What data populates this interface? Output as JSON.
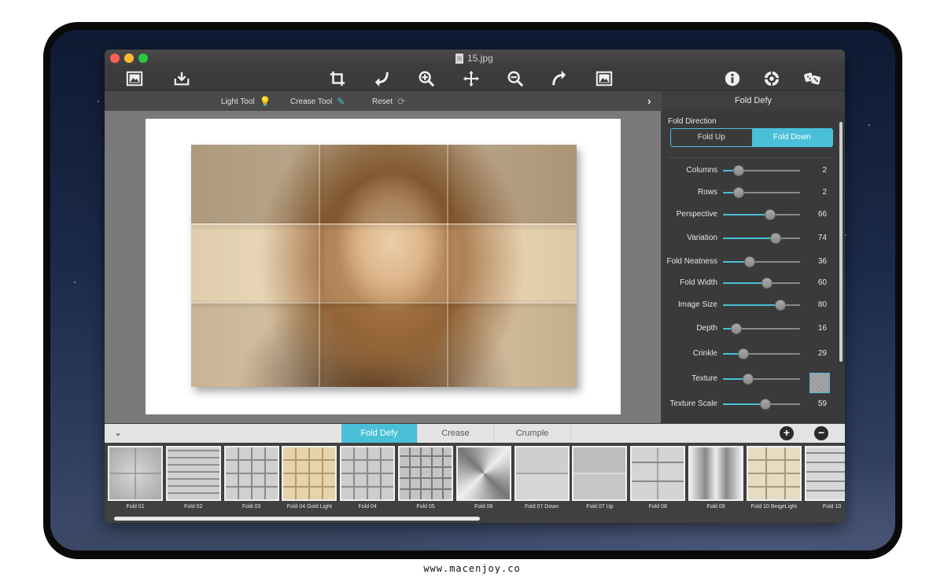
{
  "window": {
    "title": "15.jpg"
  },
  "toolbar": {
    "icons": [
      "image-icon",
      "import-icon",
      "crop-icon",
      "undo-icon",
      "zoom-in-icon",
      "move-icon",
      "zoom-out-icon",
      "redo-icon",
      "fit-image-icon",
      "info-icon",
      "settings-icon",
      "random-dice-icon"
    ]
  },
  "subbar": {
    "light_tool": "Light Tool",
    "crease_tool": "Crease Tool",
    "reset": "Reset"
  },
  "panel": {
    "title": "Fold Defy",
    "fold_direction_label": "Fold Direction",
    "fold_up": "Fold Up",
    "fold_down": "Fold Down",
    "fold_direction_selected": "Fold Down",
    "sliders": [
      {
        "label": "Columns",
        "value": "2",
        "fraction": 0.2
      },
      {
        "label": "Rows",
        "value": "2",
        "fraction": 0.2
      },
      {
        "label": "Perspective",
        "value": "66",
        "fraction": 0.61
      },
      {
        "label": "Variation",
        "value": "74",
        "fraction": 0.68
      },
      {
        "label": "Fold Neatness",
        "value": "36",
        "fraction": 0.35
      },
      {
        "label": "Fold Width",
        "value": "60",
        "fraction": 0.57
      },
      {
        "label": "Image Size",
        "value": "80",
        "fraction": 0.74
      },
      {
        "label": "Depth",
        "value": "16",
        "fraction": 0.17
      },
      {
        "label": "Crinkle",
        "value": "29",
        "fraction": 0.27
      },
      {
        "label": "Texture",
        "value": "",
        "fraction": 0.33
      },
      {
        "label": "Texture Scale",
        "value": "59",
        "fraction": 0.55
      }
    ]
  },
  "tabs": [
    {
      "label": "Fold Defy",
      "active": true
    },
    {
      "label": "Crease",
      "active": false
    },
    {
      "label": "Crumple",
      "active": false
    }
  ],
  "presets": [
    {
      "label": "Fold 01"
    },
    {
      "label": "Fold 02"
    },
    {
      "label": "Fold 03"
    },
    {
      "label": "Fold 04 Gold Light"
    },
    {
      "label": "Fold 04"
    },
    {
      "label": "Fold 05"
    },
    {
      "label": "Fold 06"
    },
    {
      "label": "Fold 07 Down"
    },
    {
      "label": "Fold 07 Up"
    },
    {
      "label": "Fold 08"
    },
    {
      "label": "Fold 09"
    },
    {
      "label": "Fold 10 BeigeLight"
    },
    {
      "label": "Fold 10"
    }
  ],
  "footer": {
    "url": "www.macenjoy.co"
  },
  "colors": {
    "accent": "#4ac0d8"
  }
}
